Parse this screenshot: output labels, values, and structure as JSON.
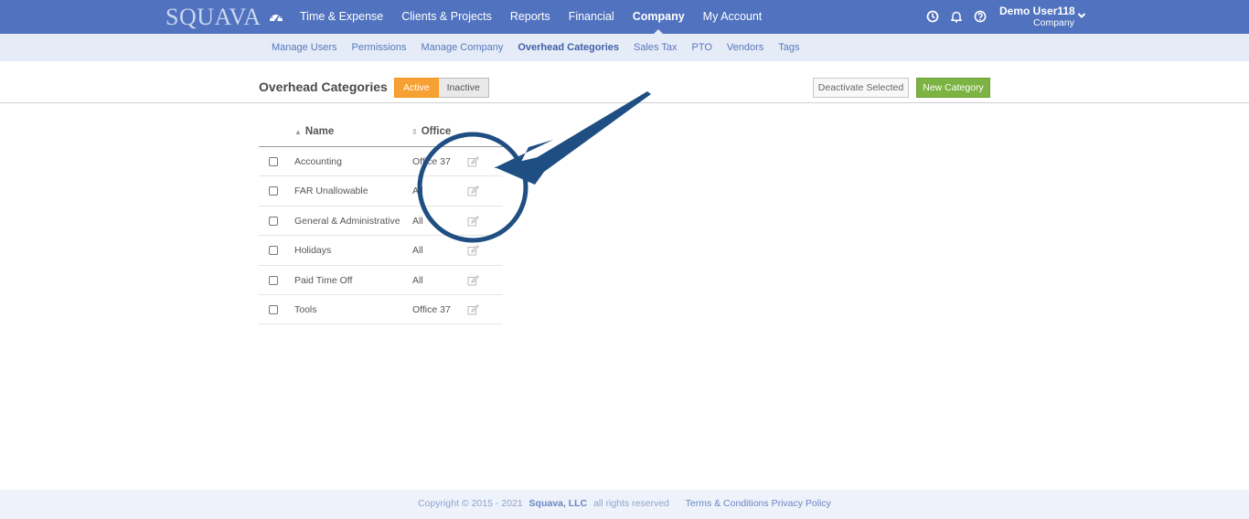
{
  "header": {
    "logo": "SQUAVA",
    "nav": [
      {
        "label": "Time & Expense"
      },
      {
        "label": "Clients & Projects"
      },
      {
        "label": "Reports"
      },
      {
        "label": "Financial"
      },
      {
        "label": "Company",
        "active": true
      },
      {
        "label": "My Account"
      }
    ],
    "user": {
      "name": "Demo User118",
      "role": "Company"
    }
  },
  "subnav": [
    {
      "label": "Manage Users"
    },
    {
      "label": "Permissions"
    },
    {
      "label": "Manage Company"
    },
    {
      "label": "Overhead Categories",
      "active": true
    },
    {
      "label": "Sales Tax"
    },
    {
      "label": "PTO"
    },
    {
      "label": "Vendors"
    },
    {
      "label": "Tags"
    }
  ],
  "page": {
    "title": "Overhead Categories",
    "toggle": {
      "active": "Active",
      "inactive": "Inactive"
    },
    "deactivate_label": "Deactivate Selected",
    "new_label": "New Category"
  },
  "table": {
    "columns": {
      "name": "Name",
      "office": "Office"
    },
    "rows": [
      {
        "name": "Accounting",
        "office": "Office 37"
      },
      {
        "name": "FAR Unallowable",
        "office": "All"
      },
      {
        "name": "General & Administrative",
        "office": "All"
      },
      {
        "name": "Holidays",
        "office": "All"
      },
      {
        "name": "Paid Time Off",
        "office": "All"
      },
      {
        "name": "Tools",
        "office": "Office 37"
      }
    ]
  },
  "footer": {
    "copyright": "Copyright © 2015 - 2021",
    "company": "Squava, LLC",
    "rights": "all rights reserved",
    "terms": "Terms & Conditions",
    "privacy": "Privacy Policy"
  },
  "colors": {
    "topbar": "#5072bf",
    "subbar": "#e6ecf7",
    "active_toggle": "#f7a134",
    "new_button": "#7cb342",
    "annotation": "#1f4e82"
  },
  "icons": {
    "dashboard": "dashboard-icon",
    "clock": "clock-icon",
    "bell": "bell-icon",
    "help": "help-icon",
    "edit": "edit-icon"
  }
}
